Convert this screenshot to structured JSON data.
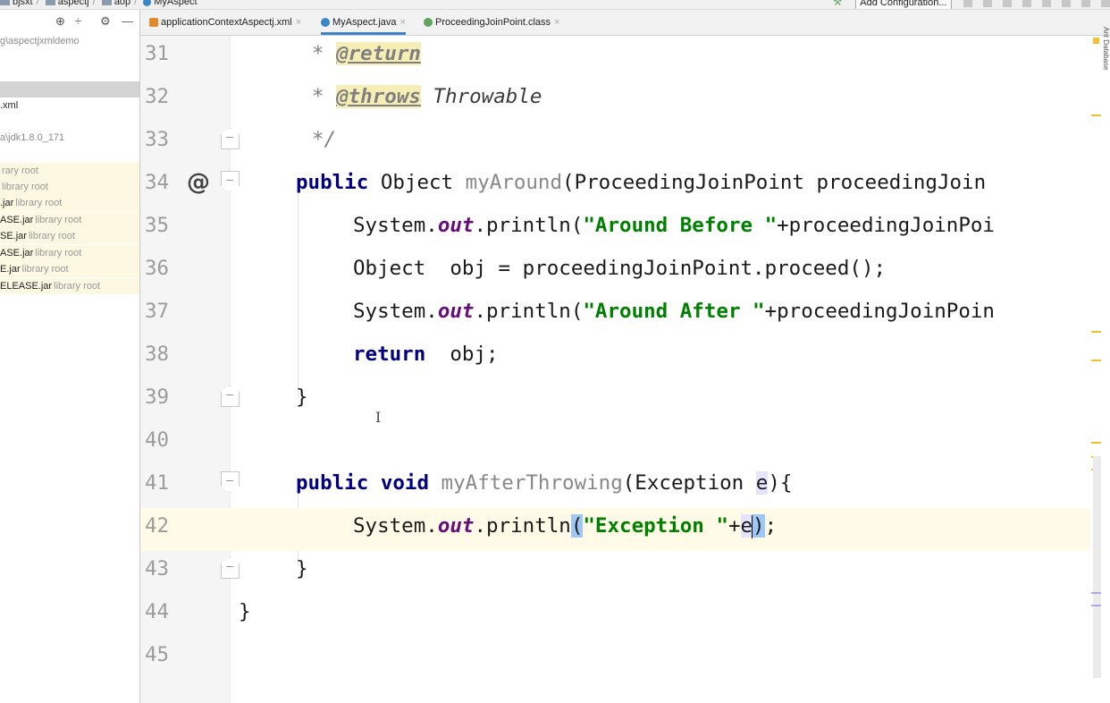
{
  "navbar": {
    "breadcrumbs": [
      "bjsxt",
      "aspectj",
      "aop",
      "MyAspect"
    ],
    "add_configuration": "Add Configuration..."
  },
  "project_panel": {
    "rows": [
      {
        "text": "g\\aspectjxmldemo",
        "tag": "",
        "style": "muted"
      },
      {
        "text": "",
        "tag": "",
        "style": "selected"
      },
      {
        "text": ".xml",
        "tag": "",
        "style": "plain"
      },
      {
        "text": "a\\jdk1.8.0_171",
        "tag": "",
        "style": "muted"
      },
      {
        "text": "",
        "tag": "rary root",
        "style": "lib"
      },
      {
        "text": "",
        "tag": "library root",
        "style": "lib"
      },
      {
        "text": ".jar",
        "tag": "library root",
        "style": "lib"
      },
      {
        "text": "ASE.jar",
        "tag": "library root",
        "style": "lib"
      },
      {
        "text": "SE.jar",
        "tag": "library root",
        "style": "lib"
      },
      {
        "text": "ASE.jar",
        "tag": "library root",
        "style": "lib"
      },
      {
        "text": "E.jar",
        "tag": "library root",
        "style": "lib"
      },
      {
        "text": "ELEASE.jar",
        "tag": "library root",
        "style": "lib"
      }
    ]
  },
  "tabs": [
    {
      "label": "applicationContextAspectj.xml",
      "icon": "xml-file-icon",
      "active": false
    },
    {
      "label": "MyAspect.java",
      "icon": "java-class-icon",
      "active": true
    },
    {
      "label": "ProceedingJoinPoint.class",
      "icon": "interface-class-icon",
      "active": false
    }
  ],
  "editor": {
    "line_numbers": [
      "31",
      "32",
      "33",
      "34",
      "35",
      "36",
      "37",
      "38",
      "39",
      "40",
      "41",
      "42",
      "43",
      "44",
      "45"
    ],
    "code": {
      "l31": {
        "star": "* ",
        "tag": "@return"
      },
      "l32": {
        "star": "* ",
        "tag": "@throws",
        "rest": " Throwable"
      },
      "l33": {
        "end": "*/"
      },
      "l34": {
        "kw": "public",
        "type": " Object ",
        "name": "myAround",
        "rest": "(ProceedingJoinPoint proceedingJoin"
      },
      "l35": {
        "a": "System.",
        "f": "out",
        "b": ".println(",
        "s": "\"Around Before \"",
        "c": "+proceedingJoinPoi"
      },
      "l36": {
        "a": "Object  obj = proceedingJoinPoint.proceed();"
      },
      "l37": {
        "a": "System.",
        "f": "out",
        "b": ".println(",
        "s": "\"Around After \"",
        "c": "+proceedingJoinPoin"
      },
      "l38": {
        "kw": "return",
        "rest": "  obj;"
      },
      "l39": {
        "a": "}"
      },
      "l41": {
        "kw": "public void",
        "name": " myAfterThrowing",
        "b": "(Exception ",
        "v": "e",
        "c": "){"
      },
      "l42": {
        "a": "System.",
        "f": "out",
        "b": ".println",
        "p": "(",
        "s": "\"Exception \"",
        "c": "+",
        "v": "e",
        "d": ")",
        "e": ";"
      },
      "l43": {
        "a": "}"
      },
      "l44": {
        "a": "}"
      }
    }
  },
  "side_panel_labels": "Ant  Database"
}
